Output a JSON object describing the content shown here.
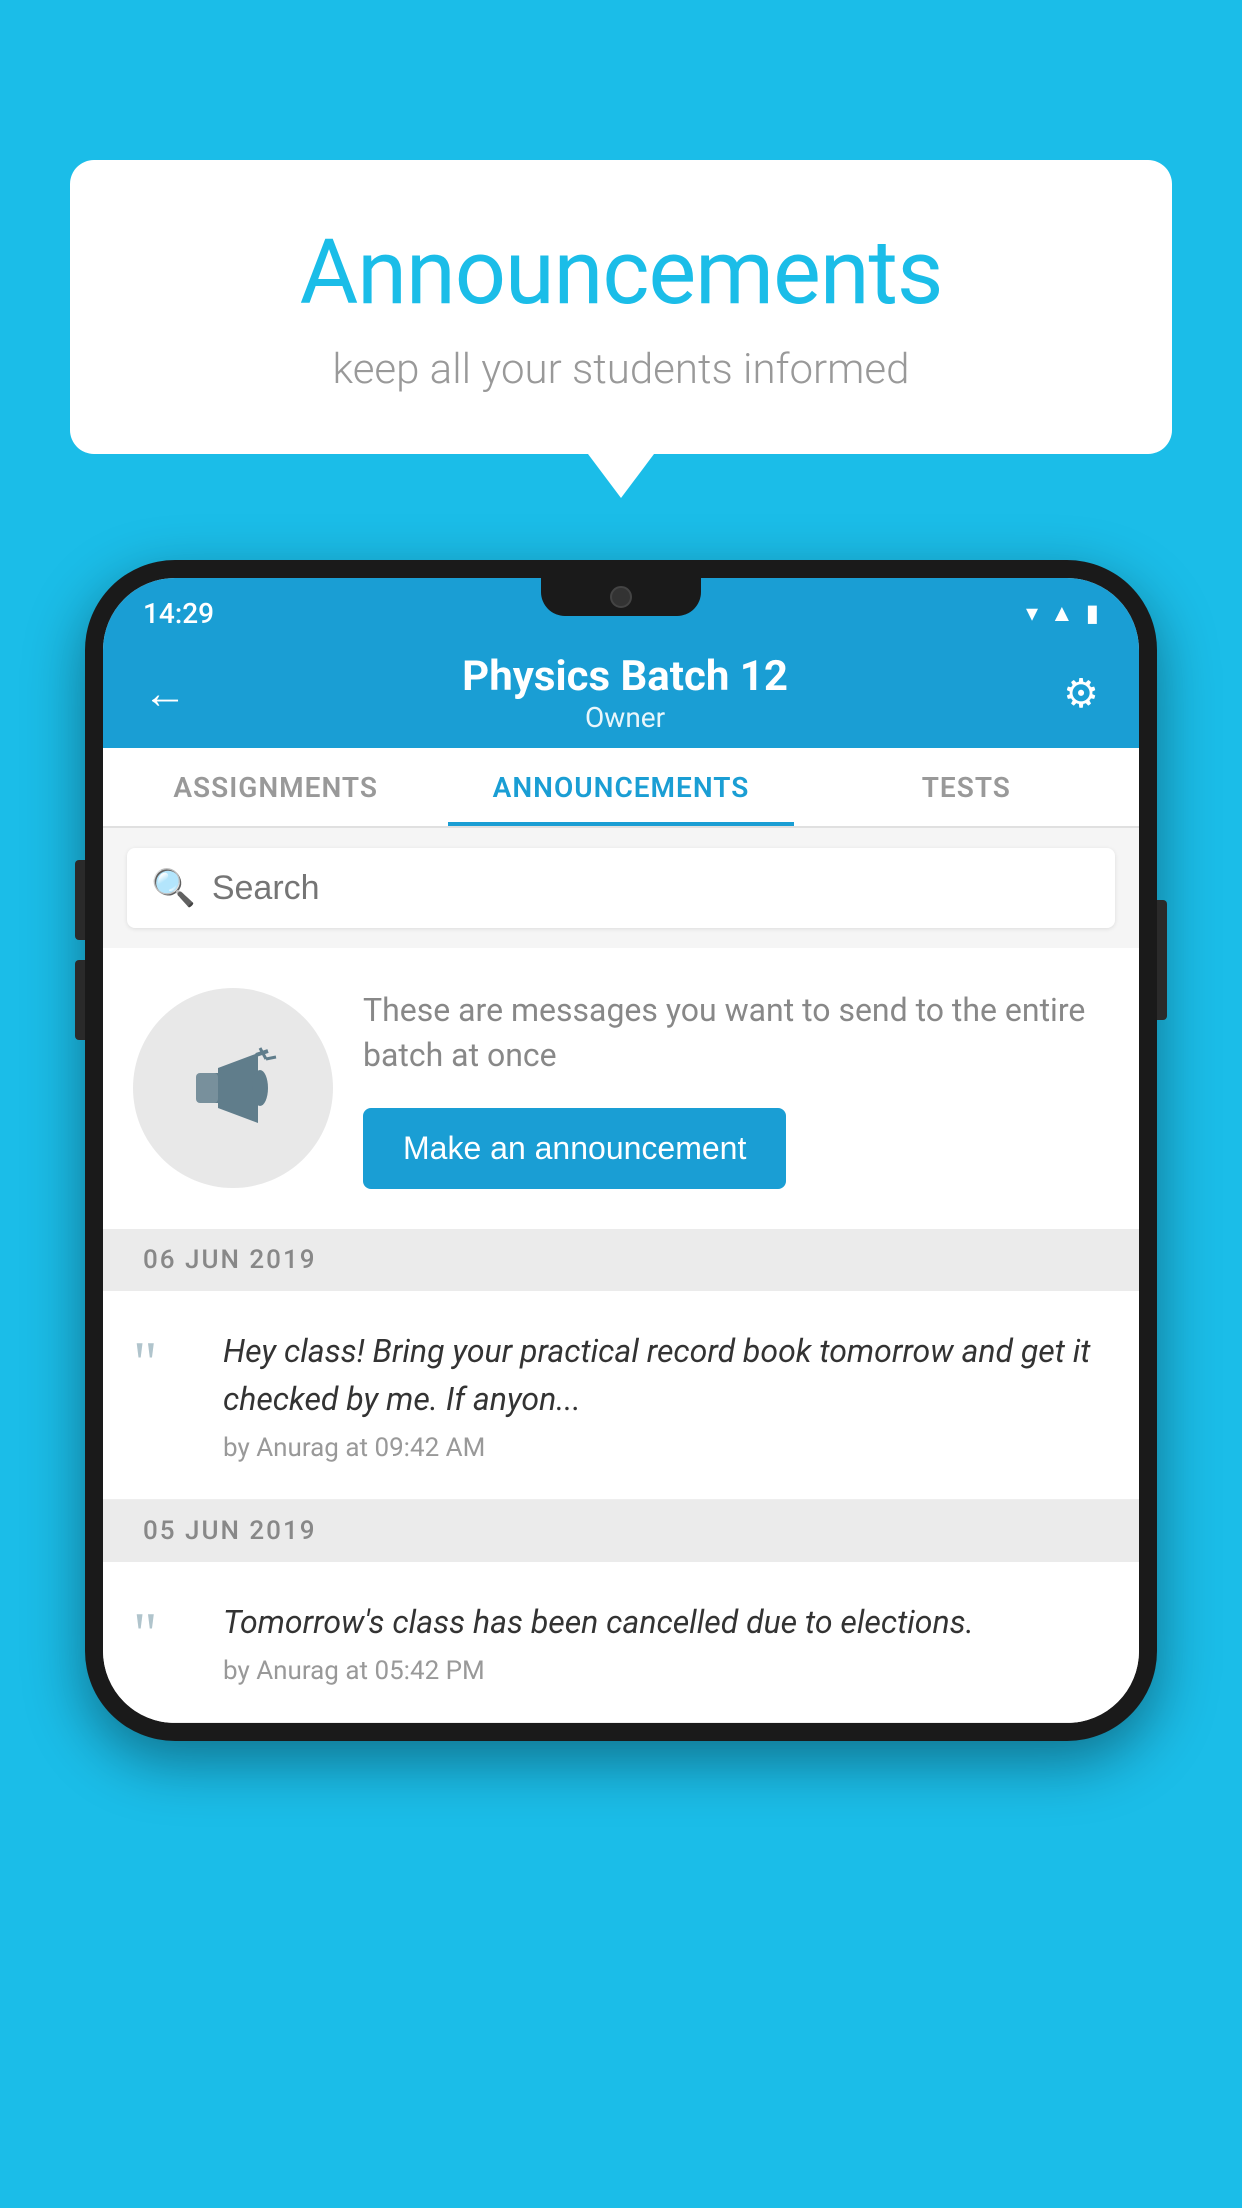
{
  "background_color": "#1bbde8",
  "speech_bubble": {
    "title": "Announcements",
    "subtitle": "keep all your students informed"
  },
  "phone": {
    "status_bar": {
      "time": "14:29",
      "icons": [
        "wifi",
        "signal",
        "battery"
      ]
    },
    "app_bar": {
      "title": "Physics Batch 12",
      "subtitle": "Owner",
      "back_label": "←",
      "gear_label": "⚙"
    },
    "tabs": [
      {
        "label": "ASSIGNMENTS",
        "active": false
      },
      {
        "label": "ANNOUNCEMENTS",
        "active": true
      },
      {
        "label": "TESTS",
        "active": false
      }
    ],
    "search": {
      "placeholder": "Search"
    },
    "promo": {
      "description": "These are messages you want to send to the entire batch at once",
      "button_label": "Make an announcement"
    },
    "announcements": [
      {
        "date": "06  JUN  2019",
        "message": "Hey class! Bring your practical record book tomorrow and get it checked by me. If anyon...",
        "meta": "by Anurag at 09:42 AM"
      },
      {
        "date": "05  JUN  2019",
        "message": "Tomorrow's class has been cancelled due to elections.",
        "meta": "by Anurag at 05:42 PM"
      }
    ]
  }
}
